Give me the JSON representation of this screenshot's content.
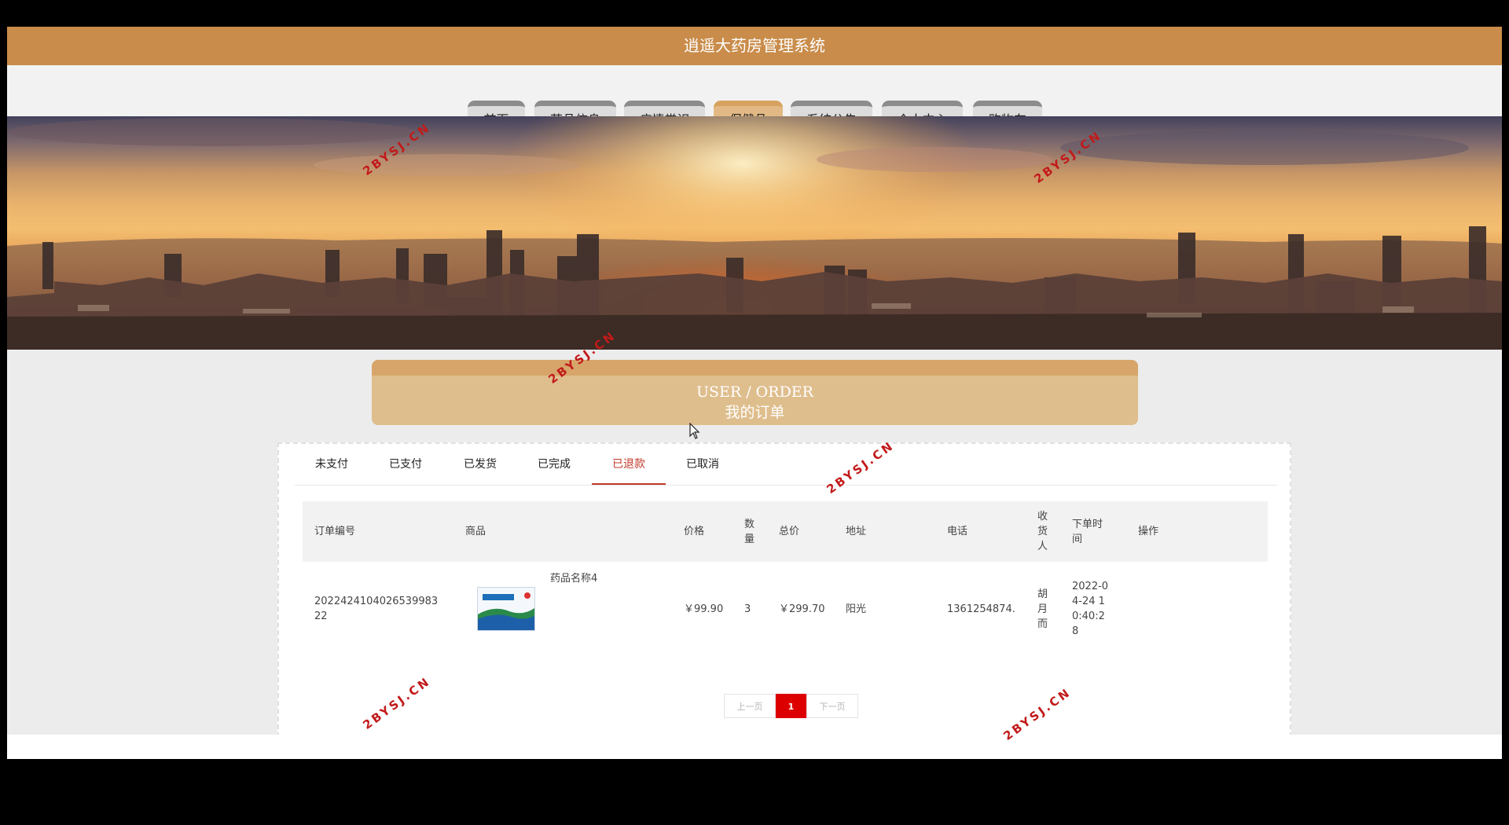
{
  "header": {
    "title": "逍遥大药房管理系统"
  },
  "nav": {
    "items": [
      {
        "label": "首页"
      },
      {
        "label": "药品信息"
      },
      {
        "label": "疫情常识"
      },
      {
        "label": "保健品"
      },
      {
        "label": "系统公告"
      },
      {
        "label": "个人中心"
      },
      {
        "label": "购物车"
      }
    ],
    "active_index": 3
  },
  "section": {
    "title_en": "USER / ORDER",
    "title_cn": "我的订单"
  },
  "tabs": {
    "items": [
      {
        "label": "未支付"
      },
      {
        "label": "已支付"
      },
      {
        "label": "已发货"
      },
      {
        "label": "已完成"
      },
      {
        "label": "已退款"
      },
      {
        "label": "已取消"
      }
    ],
    "active_index": 4
  },
  "table": {
    "columns": [
      {
        "label": "订单编号"
      },
      {
        "label": "商品"
      },
      {
        "label": "价格"
      },
      {
        "label": "数量"
      },
      {
        "label": "总价"
      },
      {
        "label": "地址"
      },
      {
        "label": "电话"
      },
      {
        "label": "收货人"
      },
      {
        "label": "下单时间"
      },
      {
        "label": "操作"
      }
    ],
    "rows": [
      {
        "order_no": "2022424104026539983 22",
        "product_name": "药品名称4",
        "price": "￥99.90",
        "quantity": "3",
        "total": "￥299.70",
        "address": "阳光",
        "phone": "1361254874.",
        "receiver": "胡月而",
        "order_time": "2022-04-24 10:40:28"
      }
    ]
  },
  "pagination": {
    "prev": "上一页",
    "current": "1",
    "next": "下一页"
  },
  "watermark": {
    "text": "2BYSJ.CN"
  },
  "colors": {
    "header": "#c98c4a",
    "nav_active": "#e2b985",
    "accent_red": "#c0392b",
    "page_current": "#dd0000"
  },
  "icons": [
    "mouse-cursor-icon"
  ]
}
